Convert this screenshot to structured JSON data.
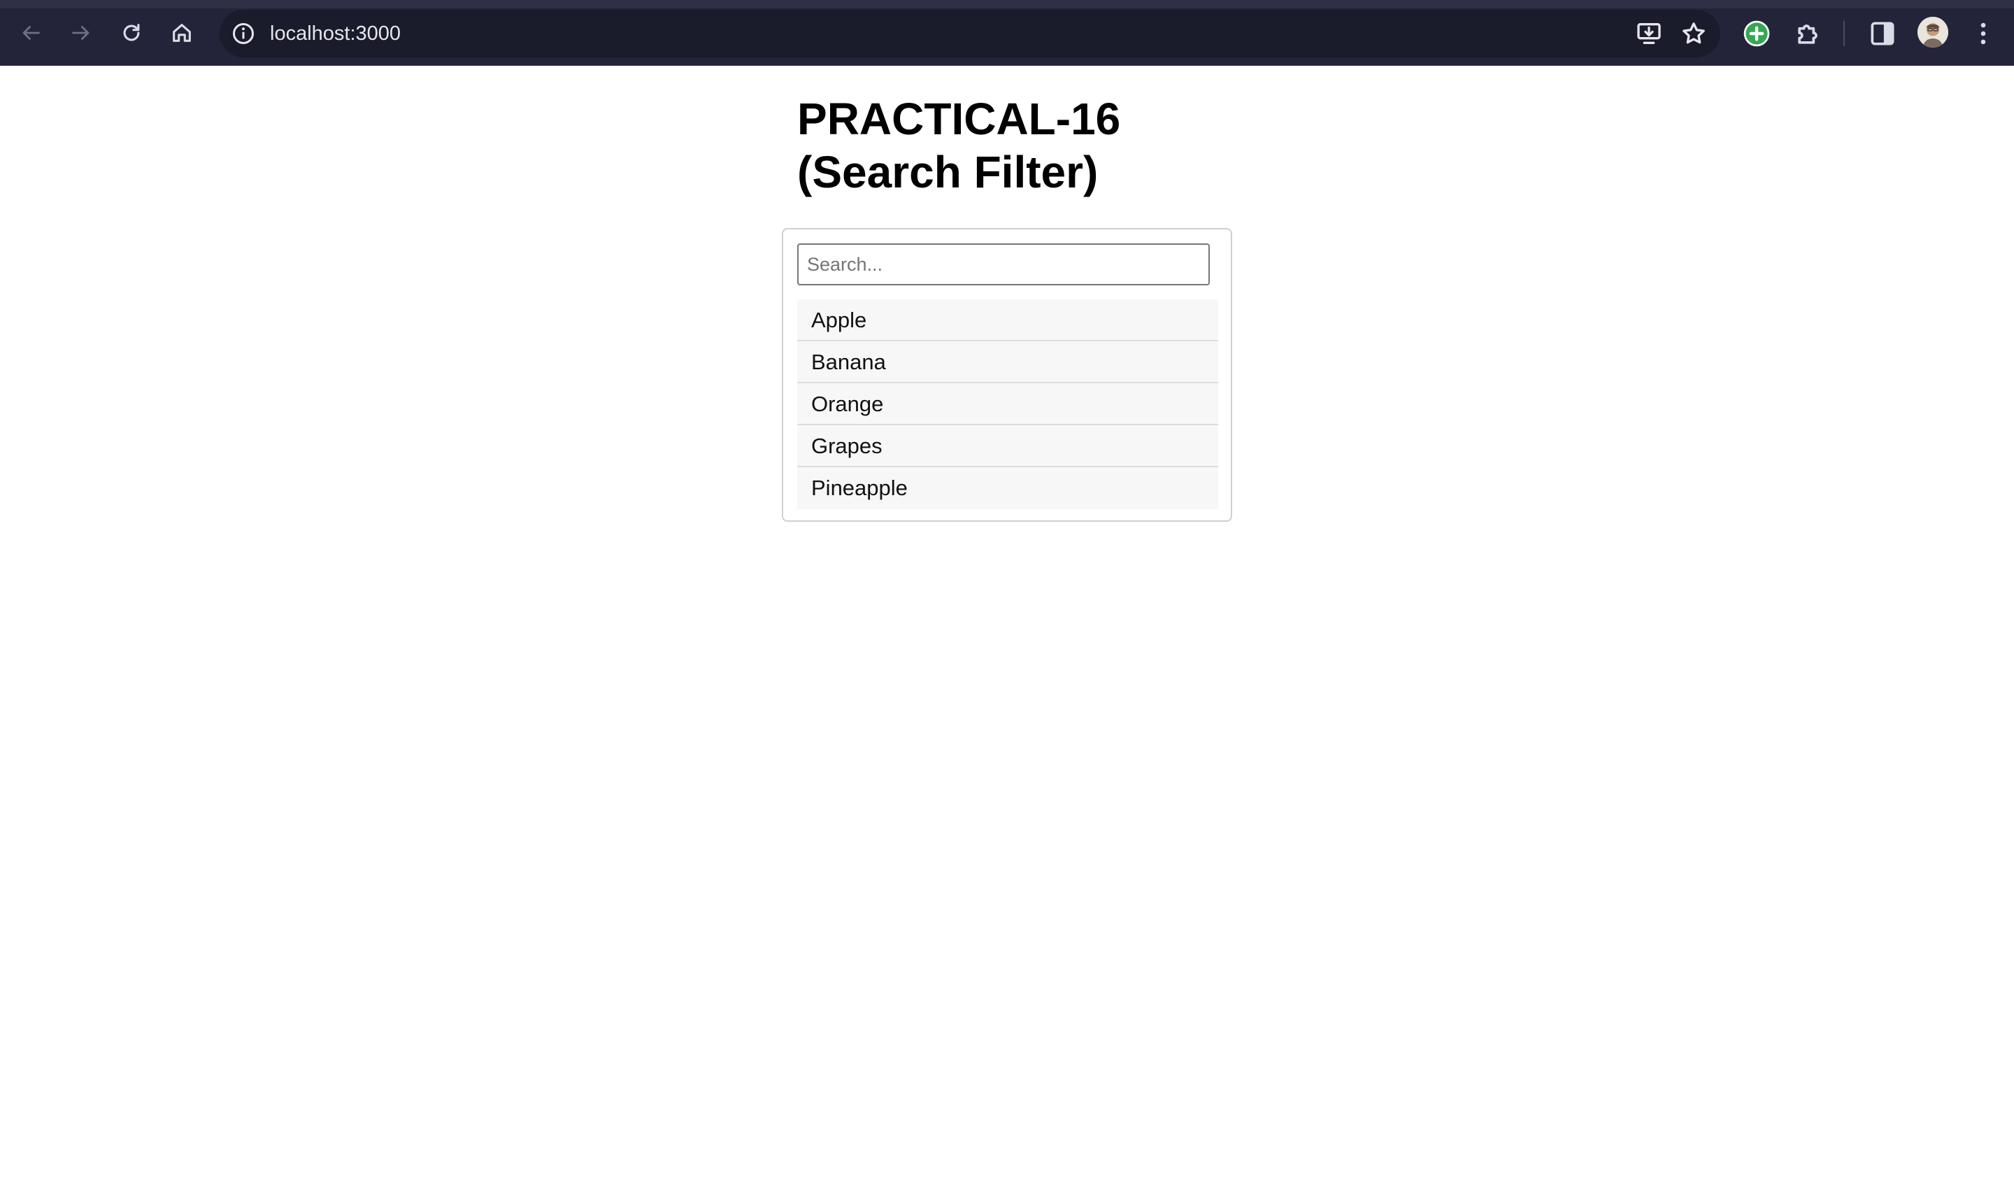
{
  "browser": {
    "url": "localhost:3000",
    "icons": [
      "back-arrow-icon",
      "forward-arrow-icon",
      "reload-icon",
      "home-icon",
      "site-info-icon",
      "install-app-icon",
      "bookmark-star-icon",
      "extension-add-icon",
      "extensions-puzzle-icon",
      "side-panel-icon",
      "avatar",
      "more-menu-icon"
    ],
    "colors": {
      "toolbar": "#23243a",
      "omnibox": "#1a1b2b",
      "extension_green": "#34a853"
    }
  },
  "page": {
    "title_line1": "PRACTICAL-16",
    "title_line2": "(Search Filter)",
    "search": {
      "placeholder": "Search...",
      "value": ""
    },
    "items": [
      {
        "label": "Apple"
      },
      {
        "label": "Banana"
      },
      {
        "label": "Orange"
      },
      {
        "label": "Grapes"
      },
      {
        "label": "Pineapple"
      }
    ]
  }
}
